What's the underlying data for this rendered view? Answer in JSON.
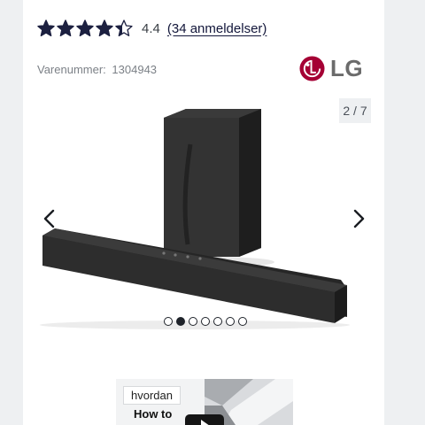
{
  "rating": {
    "value": "4.4",
    "stars_filled": 4.4,
    "stars_max": 5,
    "reviews_link": "(34 anmeldelser)",
    "star_color": "#1c2040"
  },
  "product": {
    "sku_label": "Varenummer:",
    "sku_value": "1304943"
  },
  "brand": {
    "logo_text": "LG",
    "logo_color": "#a50034"
  },
  "gallery": {
    "counter": "2 / 7",
    "current_index": 2,
    "total": 7,
    "dots": [
      false,
      true,
      false,
      false,
      false,
      false,
      false
    ],
    "prev_icon": "chevron-left-icon",
    "next_icon": "chevron-right-icon"
  },
  "video": {
    "tag": "hvordan",
    "title": "How to",
    "play_icon": "play-icon"
  }
}
